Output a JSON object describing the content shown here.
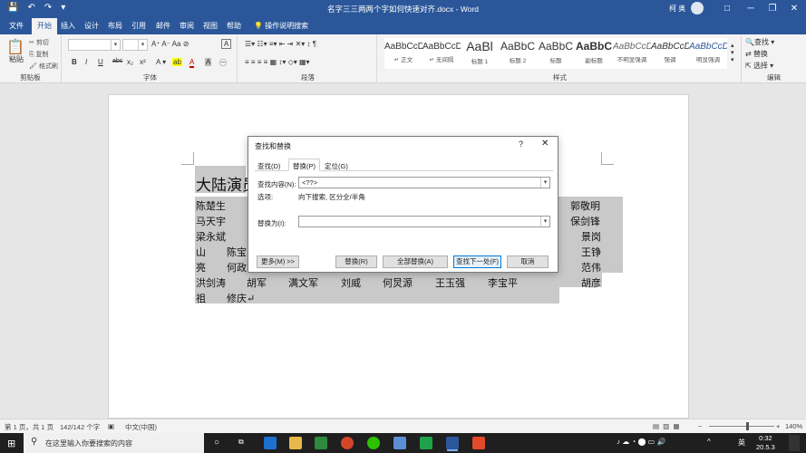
{
  "window": {
    "title": "名字三三两两个字如何快速对齐.docx - Word",
    "user": "柯 奥",
    "qat": [
      "💾",
      "↶",
      "↷",
      "▾"
    ],
    "controls": [
      "□",
      "─",
      "❐",
      "✕"
    ]
  },
  "tabs": [
    "文件",
    "开始",
    "插入",
    "设计",
    "布局",
    "引用",
    "邮件",
    "审阅",
    "视图",
    "帮助"
  ],
  "active_tab": "开始",
  "tell_me": "操作说明搜索",
  "ribbon": {
    "clipboard": {
      "label": "剪贴板",
      "paste": "粘贴",
      "cut": "剪切",
      "copy": "复制",
      "format_painter": "格式刷"
    },
    "font": {
      "label": "字体",
      "buttons": [
        "B",
        "I",
        "U",
        "abc",
        "x₂",
        "x²",
        "A"
      ]
    },
    "paragraph": {
      "label": "段落"
    },
    "styles": {
      "label": "样式",
      "items": [
        {
          "preview": "AaBbCcDc",
          "name": "↵ 正文"
        },
        {
          "preview": "AaBbCcDc",
          "name": "↵ 无间隔"
        },
        {
          "preview": "AaBl",
          "name": "标题 1"
        },
        {
          "preview": "AaBbC",
          "name": "标题 2"
        },
        {
          "preview": "AaBbC",
          "name": "标题"
        },
        {
          "preview": "AaBbC",
          "name": "副标题"
        },
        {
          "preview": "AaBbCcD",
          "name": "不明显强调"
        },
        {
          "preview": "AaBbCcD",
          "name": "强调"
        },
        {
          "preview": "AaBbCcD",
          "name": "明显强调"
        }
      ]
    },
    "editing": {
      "label": "编辑",
      "find": "查找 ▾",
      "replace": "替换",
      "select": "选择 ▾"
    }
  },
  "document": {
    "title": "大陆演员",
    "rows": [
      [
        "陈楚生",
        "郭敬明"
      ],
      [
        "马天宇",
        "保剑锋"
      ],
      [
        "梁永斌",
        "景岗"
      ],
      [
        "山",
        "陈宝",
        "王铮"
      ],
      [
        "亮",
        "何政",
        "范伟"
      ],
      [
        "洪剑涛",
        "胡军",
        "满文军",
        "刘威",
        "何炅源",
        "王玉强",
        "李宝平",
        "胡彦"
      ],
      [
        "祖",
        "修庆↵"
      ]
    ]
  },
  "dialog": {
    "title": "查找和替换",
    "help": "?",
    "close": "✕",
    "tabs": [
      "查找(D)",
      "替换(P)",
      "定位(G)"
    ],
    "active_tab": "替换(P)",
    "find_label": "查找内容(N):",
    "find_value": "<??>",
    "options_label": "选项:",
    "options_value": "向下搜索, 区分全/半角",
    "replace_label": "替换为(I):",
    "replace_value": "",
    "buttons": {
      "more": "更多(M) >>",
      "replace": "替换(R)",
      "replace_all": "全部替换(A)",
      "find_next": "查找下一处(F)",
      "cancel": "取消"
    }
  },
  "status": {
    "page": "第 1 页，共 1 页",
    "words": "142/142 个字",
    "language": "中文(中国)",
    "zoom": "140%"
  },
  "taskbar": {
    "search_placeholder": "在这里输入你要搜索的内容",
    "tray": [
      "^",
      "ENG",
      "英"
    ],
    "time": "0:32",
    "date": "20.5.3"
  }
}
